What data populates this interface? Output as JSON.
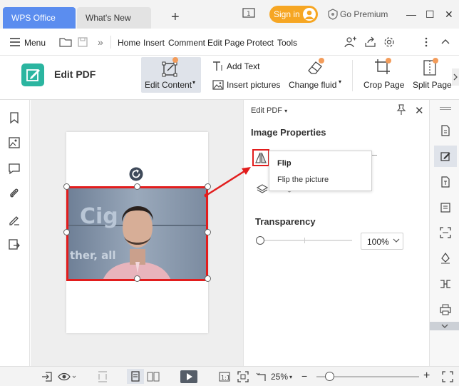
{
  "titlebar": {
    "tabs": [
      "WPS Office",
      "What's New"
    ],
    "new_tab": "+",
    "signin": "Sign in",
    "premium": "Go Premium",
    "window_buttons": [
      "—",
      "☐",
      "✕"
    ]
  },
  "menubar": {
    "menu_label": "Menu",
    "chevron": "»",
    "items": [
      "Home",
      "Insert",
      "Comment",
      "Edit Page",
      "Protect",
      "Tools"
    ]
  },
  "ribbon": {
    "title": "Edit PDF",
    "edit_content": "Edit Content",
    "add_text": "Add Text",
    "insert_pictures": "Insert pictures",
    "change_fluid": "Change fluid",
    "crop_page": "Crop Page",
    "split_page": "Split Page"
  },
  "panel": {
    "header": "Edit PDF",
    "section_title": "Image Properties",
    "tooltip_title": "Flip",
    "tooltip_desc": "Flip the picture",
    "transparency_label": "Transparency",
    "transparency_value": "100%",
    "transparency_level": 1.0
  },
  "statusbar": {
    "zoom": "25%",
    "zoom_minus": "−",
    "zoom_plus": "+"
  },
  "colors": {
    "active_tab": "#5b8def",
    "signin": "#f6a623",
    "edit_pdf": "#2bb5a0",
    "highlight": "#e21d1d"
  }
}
